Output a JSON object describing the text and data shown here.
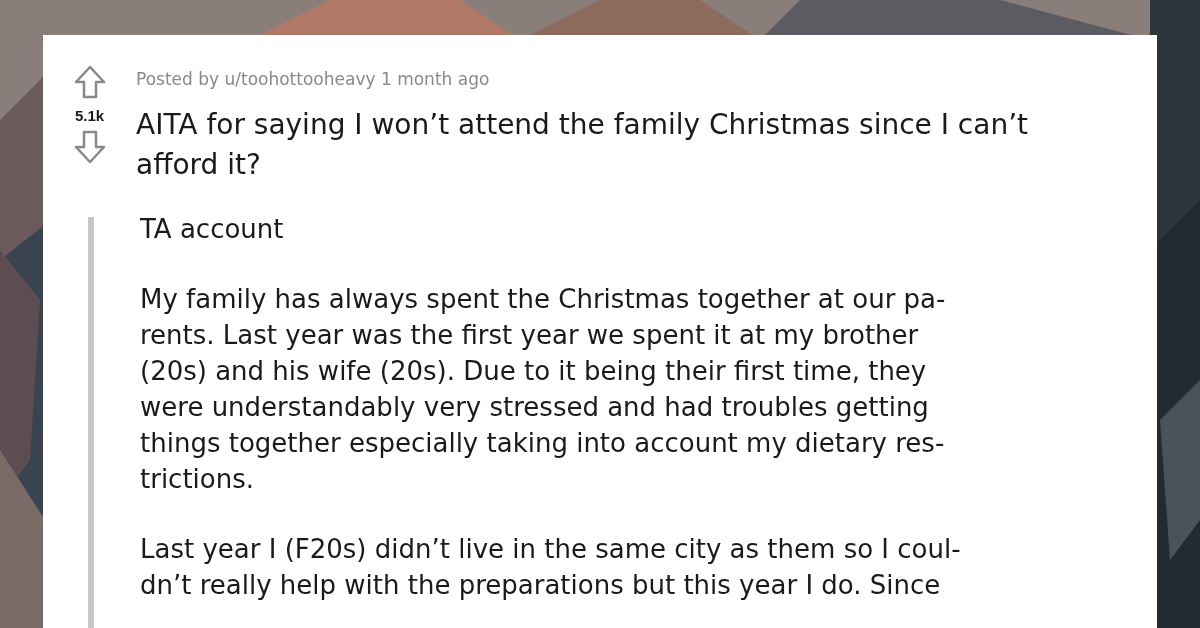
{
  "post": {
    "posted_by": "Posted by u/toohottooheavy 1 month ago",
    "score": "5.1k",
    "title_lines": [
      "AITA for saying I won’t attend the family Christmas since I can’t",
      "afford it?"
    ],
    "body": [
      {
        "lines": [
          "TA account"
        ]
      },
      {
        "lines": [
          "My family has always spent the Christmas together at our pa-",
          "rents. Last year was the first year we spent it at my brother",
          "(20s) and his wife (20s). Due to it being their first time, they",
          "were understandably very stressed and had troubles getting",
          "things together especially taking into account my dietary res-",
          "trictions."
        ]
      },
      {
        "lines": [
          "Last year I (F20s) didn’t live in the same city as them so I coul-",
          "dn’t really help with the preparations but this year I do. Since"
        ]
      }
    ]
  }
}
